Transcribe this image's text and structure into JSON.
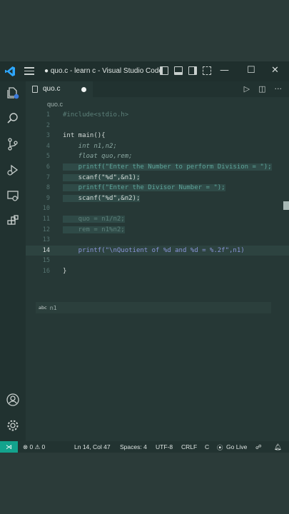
{
  "window": {
    "title": "● quo.c - learn c - Visual Studio Code",
    "controls": {
      "minimize": "—",
      "maximize": "☐",
      "close": "✕"
    }
  },
  "activity_bar": [
    "files-icon",
    "search-icon",
    "source-control-icon",
    "run-debug-icon",
    "remote-explorer-icon",
    "extensions-icon",
    "account-icon",
    "settings-gear-icon"
  ],
  "tab": {
    "label": "quo.c",
    "dirty": true
  },
  "editor_actions": {
    "run": "▷",
    "split": "◫",
    "more": "···"
  },
  "breadcrumb": "quo.c",
  "code": {
    "lines": [
      {
        "n": "1",
        "text": "#include<stdio.h>"
      },
      {
        "n": "2",
        "text": ""
      },
      {
        "n": "3",
        "text": "int main(){"
      },
      {
        "n": "4",
        "text": "    int n1,n2;"
      },
      {
        "n": "5",
        "text": "    float quo,rem;"
      },
      {
        "n": "6",
        "text": "    printf(\"Enter the Number to perform Division = \");"
      },
      {
        "n": "7",
        "text": "    scanf(\"%d\",&n1);"
      },
      {
        "n": "8",
        "text": "    printf(\"Enter the Divisor Number = \");"
      },
      {
        "n": "9",
        "text": "    scanf(\"%d\",&n2);"
      },
      {
        "n": "10",
        "text": ""
      },
      {
        "n": "11",
        "text": "    quo = n1/n2;"
      },
      {
        "n": "12",
        "text": "    rem = n1%n2;"
      },
      {
        "n": "13",
        "text": ""
      },
      {
        "n": "14",
        "text": "    printf(\"\\nQuotient of %d and %d = %.2f\",n1)"
      },
      {
        "n": "15",
        "text": ""
      },
      {
        "n": "16",
        "text": "}"
      }
    ],
    "active_line": "14",
    "suggestion": {
      "badge": "abc",
      "text": "n1"
    }
  },
  "status_bar": {
    "remote_icon": "⋊",
    "problems": "⊗ 0 ⚠ 0",
    "cursor": "Ln 14, Col 47",
    "spaces": "Spaces: 4",
    "encoding": "UTF-8",
    "eol": "CRLF",
    "language": "C",
    "go_live": "Go Live"
  },
  "colors": {
    "accent": "#13a38d",
    "background": "#2c3c3a",
    "editor": "#263836"
  }
}
